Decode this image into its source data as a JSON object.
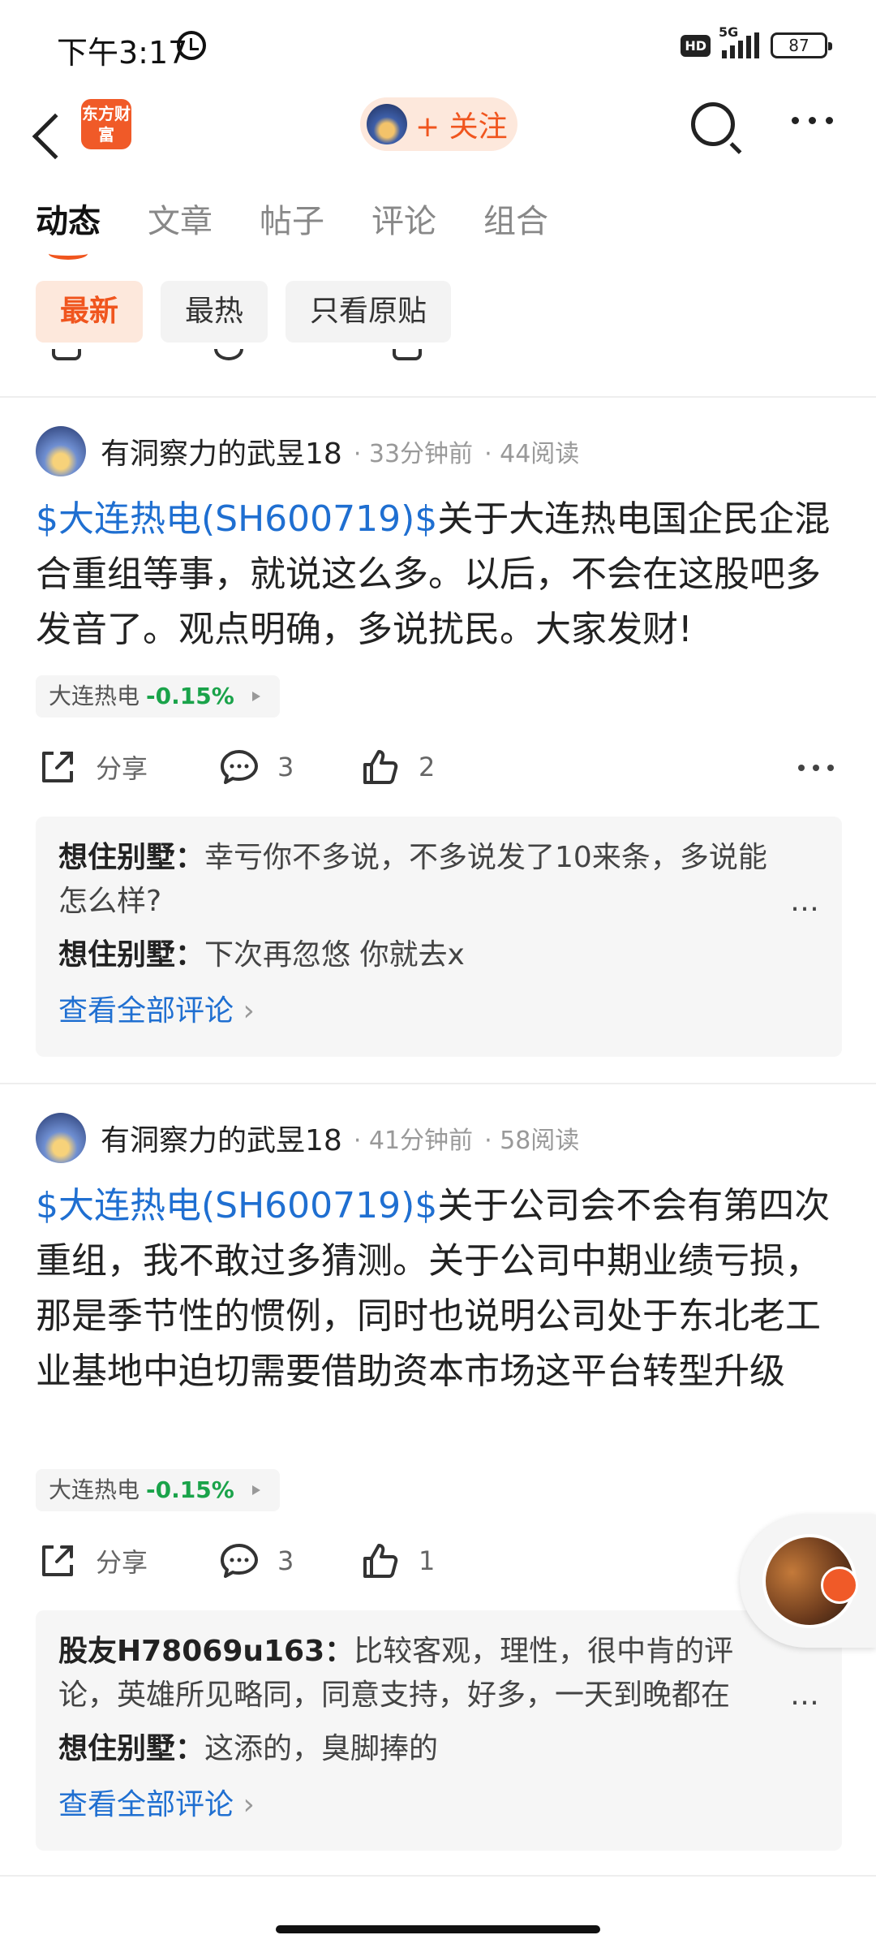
{
  "status_bar": {
    "time": "下午3:17",
    "network": "5G",
    "hd": "HD",
    "battery": "87"
  },
  "header": {
    "logo_text": "东方财富",
    "follow_label": "+ 关注"
  },
  "tabs": [
    {
      "label": "动态"
    },
    {
      "label": "文章"
    },
    {
      "label": "帖子"
    },
    {
      "label": "评论"
    },
    {
      "label": "组合"
    }
  ],
  "filters": [
    {
      "label": "最新"
    },
    {
      "label": "最热"
    },
    {
      "label": "只看原贴"
    }
  ],
  "posts": [
    {
      "author": "有洞察力的武昱18",
      "time": "· 33分钟前",
      "reads": "· 44阅读",
      "tag": "$大连热电(SH600719)$",
      "text": "关于大连热电国企民企混合重组等事，就说这么多。以后，不会在这股吧多发音了。观点明确，多说扰民。大家发财!",
      "stock_name": "大连热电",
      "stock_change": "-0.15%",
      "share_label": "分享",
      "comment_count": "3",
      "like_count": "2",
      "comments": [
        {
          "user": "想住别墅：",
          "text": "幸亏你不多说，不多说发了10来条，多说能怎么样?"
        },
        {
          "user": "想住别墅：",
          "text": "下次再忽悠 你就去x"
        }
      ],
      "view_all": "查看全部评论"
    },
    {
      "author": "有洞察力的武昱18",
      "time": "· 41分钟前",
      "reads": "· 58阅读",
      "tag": "$大连热电(SH600719)$",
      "text": "关于公司会不会有第四次重组，我不敢过多猜测。关于公司中期业绩亏损，那是季节性的惯例，同时也说明公司处于东北老工业基地中迫切需要借助资本市场这平台转型升级",
      "stock_name": "大连热电",
      "stock_change": "-0.15%",
      "share_label": "分享",
      "comment_count": "3",
      "like_count": "1",
      "comments": [
        {
          "user": "股友H78069u163：",
          "text": "比较客观，理性，很中肯的评论，英雄所见略同，同意支持，好多，一天到晚都在"
        },
        {
          "user": "想住别墅：",
          "text": "这添的，臭脚捧的"
        }
      ],
      "view_all": "查看全部评论"
    }
  ],
  "colors": {
    "accent": "#f0551e",
    "link": "#1f6fd1",
    "down": "#1aa34a"
  }
}
